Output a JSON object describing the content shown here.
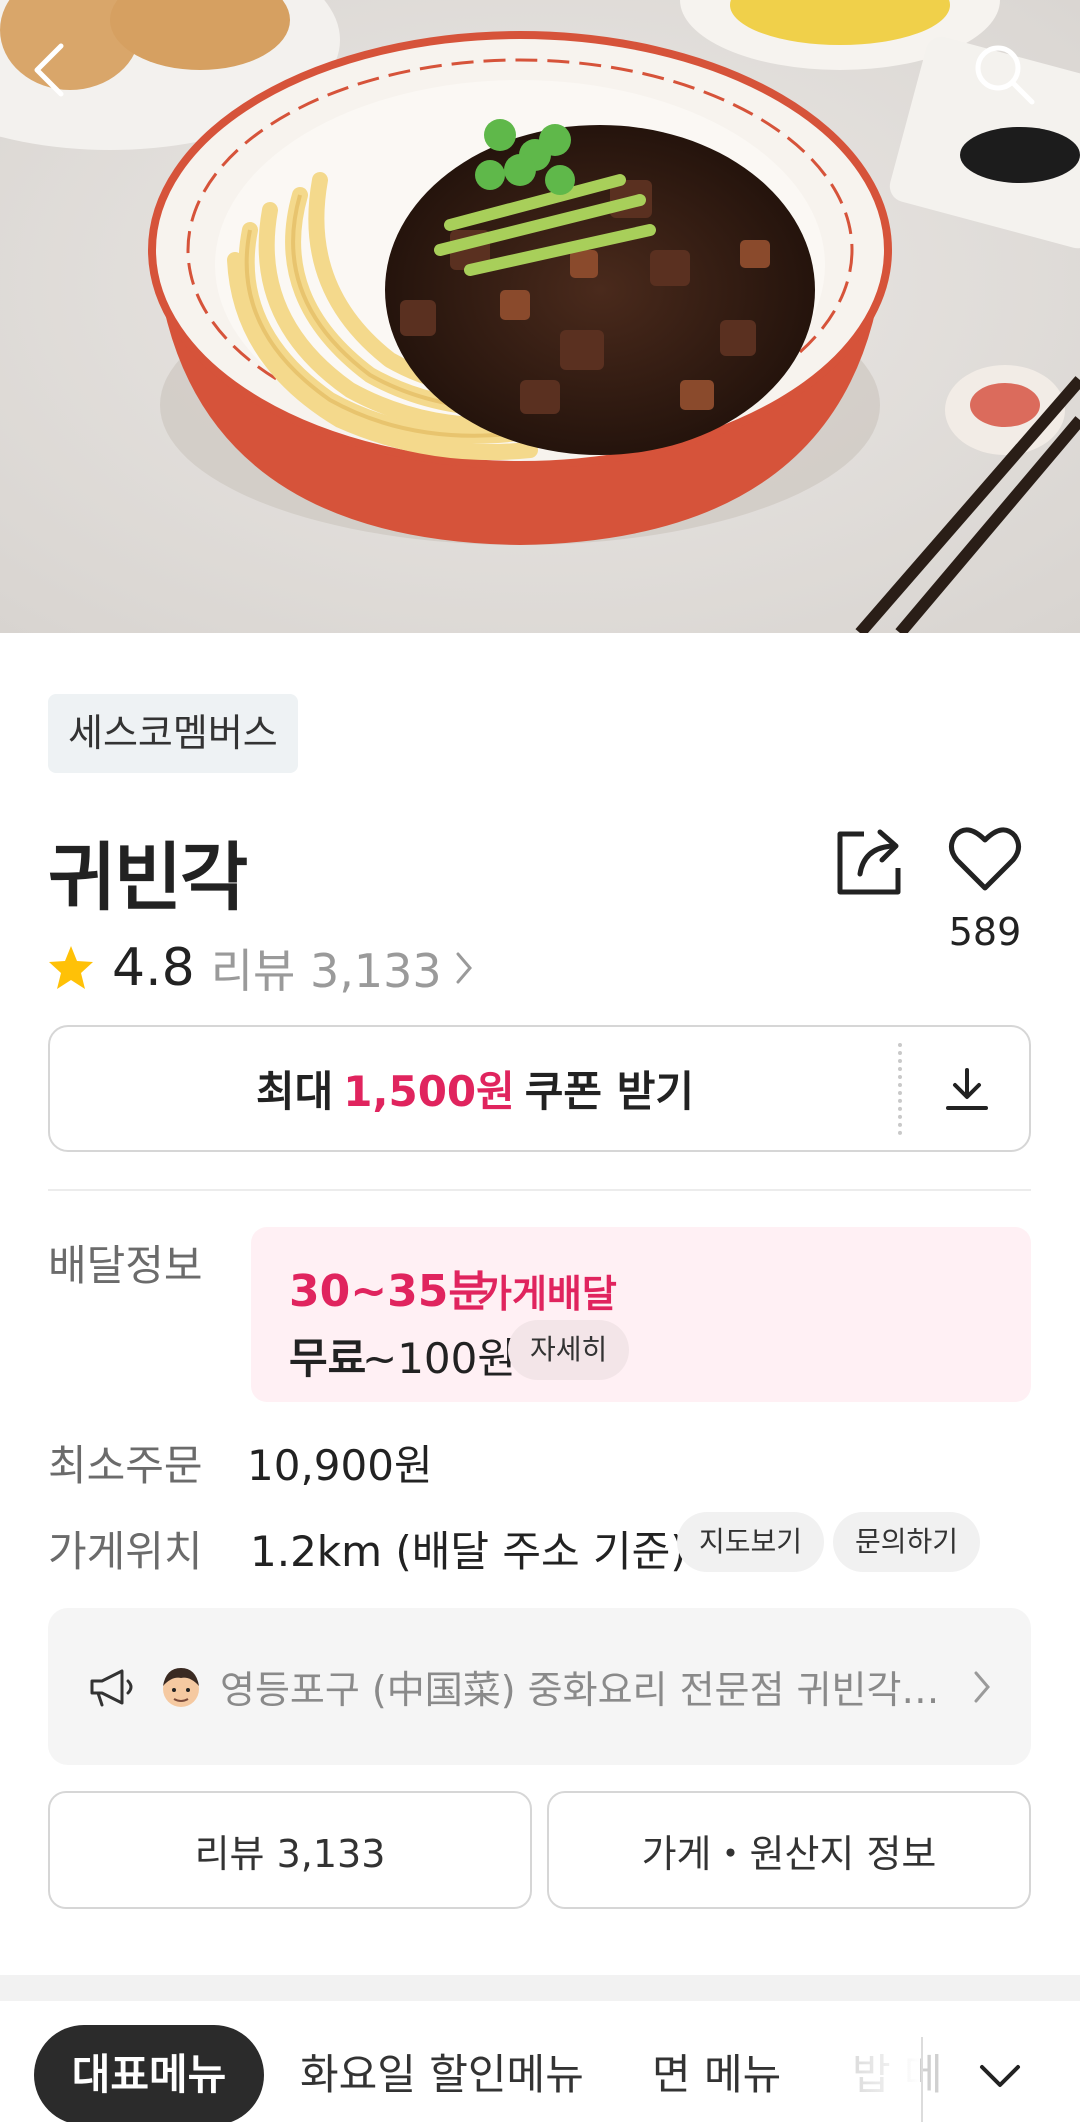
{
  "hero": {
    "image_description": "jajangmyeon-bowl-photo",
    "back_icon": "chevron-left-icon",
    "search_icon": "search-icon"
  },
  "store": {
    "badge": "세스코멤버스",
    "name": "귀빈각",
    "rating": "4.8",
    "review_label": "리뷰 3,133",
    "favorite_count": "589"
  },
  "coupon": {
    "prefix": "최대",
    "amount": "1,500원",
    "suffix": "쿠폰 받기"
  },
  "delivery": {
    "label": "배달정보",
    "time": "30~35분",
    "type": "가게배달",
    "fee_free": "무료",
    "fee_amount": "~100원",
    "detail_button": "자세히"
  },
  "min_order": {
    "label": "최소주문",
    "value": "10,900원"
  },
  "location": {
    "label": "가게위치",
    "value": "1.2km (배달 주소 기준)",
    "map_button": "지도보기",
    "inquiry_button": "문의하기"
  },
  "notice": {
    "text": "영등포구 (中国菜) 중화요리 전문점 귀빈각…"
  },
  "actions": {
    "review_button": "리뷰 3,133",
    "store_info_button": "가게・원산지 정보"
  },
  "menu_tabs": [
    {
      "label": "대표메뉴",
      "active": true
    },
    {
      "label": "화요일 할인메뉴",
      "active": false
    },
    {
      "label": "면 메뉴",
      "active": false
    },
    {
      "label": "밥 메",
      "active": false
    }
  ],
  "colors": {
    "accent": "#e0245e",
    "delivery_bg": "#fff0f4",
    "star": "#ffc107"
  }
}
